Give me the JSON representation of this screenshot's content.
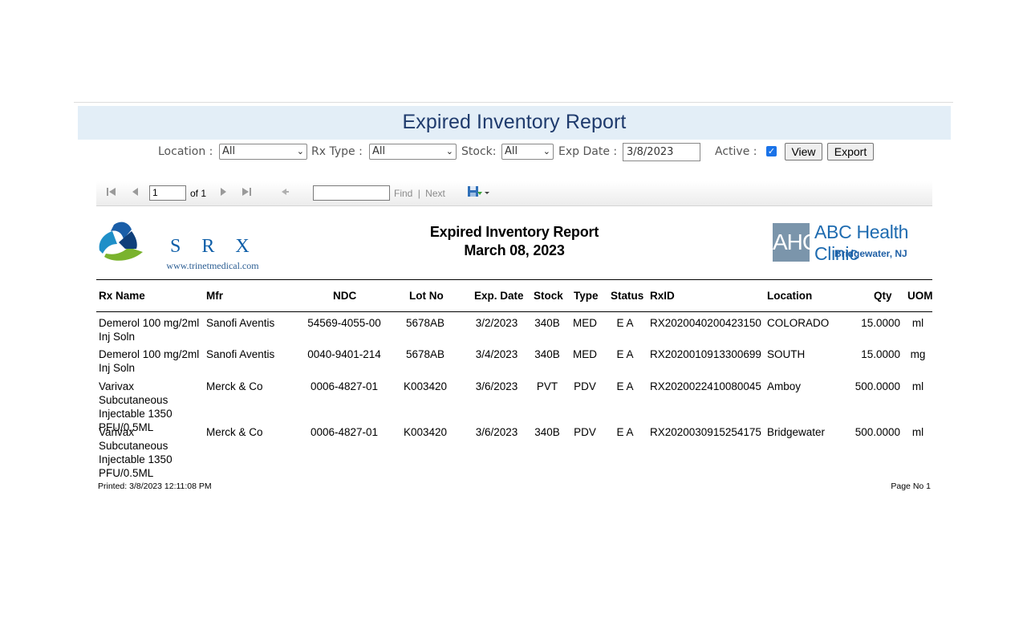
{
  "page_title": "Expired Inventory Report",
  "filters": {
    "location_label": "Location :",
    "location_value": "All",
    "rx_type_label": "Rx Type :",
    "rx_type_value": "All",
    "stock_label": "Stock:",
    "stock_value": "All",
    "exp_date_label": "Exp Date :",
    "exp_date_value": "3/8/2023",
    "active_label": "Active :",
    "active_checked": true,
    "view_label": "View",
    "export_label": "Export"
  },
  "toolbar": {
    "page_value": "1",
    "of_label": "of 1",
    "find_label": "Find",
    "separator": "|",
    "next_label": "Next"
  },
  "report": {
    "title": "Expired Inventory Report",
    "date": "March 08, 2023",
    "logo_left_text": "S R X",
    "logo_left_url": "www.trinetmedical.com",
    "logo_right_abbr": "AHC",
    "logo_right_name": "ABC Health Clinic",
    "logo_right_city": "Bridgewater, NJ",
    "columns": [
      "Rx Name",
      "Mfr",
      "NDC",
      "Lot No",
      "Exp. Date",
      "Stock",
      "Type",
      "Status",
      "RxID",
      "Location",
      "Qty",
      "UOM"
    ],
    "rows": [
      {
        "rx_name": "Demerol 100 mg/2ml Inj Soln",
        "mfr": "Sanofi Aventis",
        "ndc": "54569-4055-00",
        "lot": "5678AB",
        "exp": "3/2/2023",
        "stock": "340B",
        "type": "MED",
        "status": "E A",
        "rxid": "RX2020040200423150",
        "location": "COLORADO",
        "qty": "15.0000",
        "uom": "ml"
      },
      {
        "rx_name": "Demerol 100 mg/2ml Inj Soln",
        "mfr": "Sanofi Aventis",
        "ndc": "0040-9401-214",
        "lot": "5678AB",
        "exp": "3/4/2023",
        "stock": "340B",
        "type": "MED",
        "status": "E A",
        "rxid": "RX2020010913300699",
        "location": "SOUTH",
        "qty": "15.0000",
        "uom": "mg"
      },
      {
        "rx_name": "Varivax Subcutaneous Injectable 1350 PFU/0.5ML",
        "mfr": "Merck & Co",
        "ndc": "0006-4827-01",
        "lot": "K003420",
        "exp": "3/6/2023",
        "stock": "PVT",
        "type": "PDV",
        "status": "E A",
        "rxid": "RX2020022410080045",
        "location": "Amboy",
        "qty": "500.0000",
        "uom": "ml"
      },
      {
        "rx_name": "Varivax Subcutaneous Injectable 1350 PFU/0.5ML",
        "mfr": "Merck & Co",
        "ndc": "0006-4827-01",
        "lot": "K003420",
        "exp": "3/6/2023",
        "stock": "340B",
        "type": "PDV",
        "status": "E A",
        "rxid": "RX2020030915254175",
        "location": "Bridgewater",
        "qty": "500.0000",
        "uom": "ml"
      }
    ],
    "printed": "Printed: 3/8/2023 12:11:08 PM",
    "page_no": "Page No 1"
  },
  "icons": {
    "first_page": "first-page-icon",
    "prev_page": "prev-page-icon",
    "next_page": "next-page-icon",
    "last_page": "last-page-icon",
    "back": "back-icon",
    "save": "save-icon"
  }
}
